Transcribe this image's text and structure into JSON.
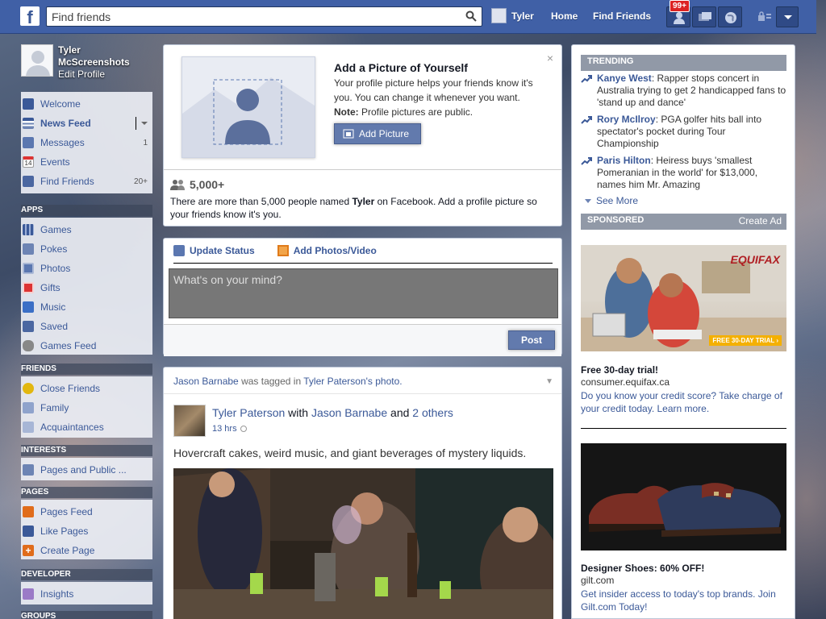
{
  "topbar": {
    "logo": "f",
    "search_placeholder": "Find friends",
    "user_name": "Tyler",
    "home": "Home",
    "find_friends": "Find Friends",
    "friend_requests_badge": "99+"
  },
  "profile": {
    "first_name": "Tyler",
    "last_name": "McScreenshots",
    "edit": "Edit Profile"
  },
  "favorites": [
    {
      "label": "Welcome",
      "count": ""
    },
    {
      "label": "News Feed",
      "count": ""
    },
    {
      "label": "Messages",
      "count": "1"
    },
    {
      "label": "Events",
      "count": ""
    },
    {
      "label": "Find Friends",
      "count": "20+"
    }
  ],
  "apps": {
    "heading": "APPS",
    "items": [
      "Games",
      "Pokes",
      "Photos",
      "Gifts",
      "Music",
      "Saved",
      "Games Feed"
    ]
  },
  "friends": {
    "heading": "FRIENDS",
    "items": [
      "Close Friends",
      "Family",
      "Acquaintances"
    ]
  },
  "interests": {
    "heading": "INTERESTS",
    "items": [
      "Pages and Public ..."
    ]
  },
  "pages": {
    "heading": "PAGES",
    "items": [
      "Pages Feed",
      "Like Pages",
      "Create Page"
    ]
  },
  "developer": {
    "heading": "DEVELOPER",
    "items": [
      "Insights"
    ]
  },
  "groups": {
    "heading": "GROUPS"
  },
  "add_picture": {
    "title": "Add a Picture of Yourself",
    "body": "Your profile picture helps your friends know it's you. You can change it whenever you want.",
    "note_label": "Note:",
    "note_text": " Profile pictures are public.",
    "button": "Add Picture",
    "close": "×",
    "count": "5,000+",
    "notice_pre": "There are more than 5,000 people named ",
    "notice_name": "Tyler",
    "notice_post": " on Facebook. Add a profile picture so your friends know it's you."
  },
  "composer": {
    "tab_status": "Update Status",
    "tab_photos": "Add Photos/Video",
    "placeholder": "What's on your mind?",
    "post": "Post"
  },
  "story": {
    "tag_actor": "Jason Barnabe",
    "tag_mid": " was tagged in ",
    "tag_target": "Tyler Paterson's photo.",
    "author": "Tyler Paterson",
    "with": " with ",
    "with_name": "Jason Barnabe",
    "and": " and ",
    "others": "2 others",
    "time": "13 hrs",
    "message": "Hovercraft cakes, weird music, and giant beverages of mystery liquids."
  },
  "trending": {
    "heading": "TRENDING",
    "items": [
      {
        "topic": "Kanye West",
        "text": ": Rapper stops concert in Australia trying to get 2 handicapped fans to 'stand up and dance'"
      },
      {
        "topic": "Rory McIlroy",
        "text": ": PGA golfer hits ball into spectator's pocket during Tour Championship"
      },
      {
        "topic": "Paris Hilton",
        "text": ": Heiress buys 'smallest Pomeranian in the world' for $13,000, names him Mr. Amazing"
      }
    ],
    "see_more": "See More"
  },
  "sponsored": {
    "heading": "SPONSORED",
    "create_ad": "Create Ad",
    "ads": [
      {
        "brand": "EQUIFAX",
        "badge": "FREE 30-DAY TRIAL ›",
        "title": "Free 30-day trial!",
        "url": "consumer.equifax.ca",
        "text": "Do you know your credit score? Take charge of your credit today. Learn more."
      },
      {
        "title": "Designer Shoes: 60% OFF!",
        "url": "gilt.com",
        "text": "Get insider access to today's top brands. Join Gilt.com Today!"
      }
    ]
  },
  "colors": {
    "brand": "#3b5998",
    "topbar": "#4060a6",
    "badge": "#dc2323"
  }
}
